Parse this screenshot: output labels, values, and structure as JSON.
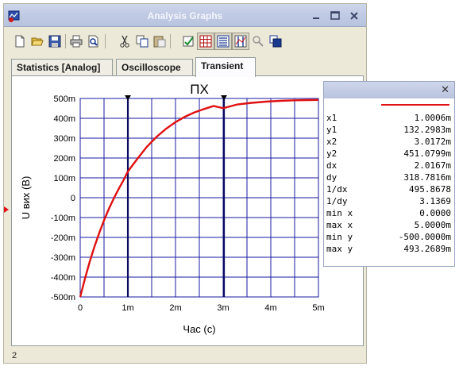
{
  "window": {
    "title": "Analysis Graphs"
  },
  "tabs": [
    {
      "label": "Statistics [Analog]",
      "active": false
    },
    {
      "label": "Oscilloscope",
      "active": false
    },
    {
      "label": "Transient",
      "active": true
    }
  ],
  "toolbar": {
    "buttons": [
      "new-icon",
      "open-icon",
      "save-icon",
      "print-icon",
      "print-preview-icon",
      "cut-icon",
      "copy-icon",
      "paste-icon",
      "properties-icon",
      "grid-icon",
      "legend-icon",
      "cursors-icon",
      "zoom-icon",
      "overlay-icon"
    ]
  },
  "status": {
    "text": "2"
  },
  "chart_data": {
    "type": "line",
    "title": "ПХ",
    "xlabel": "Час (с)",
    "ylabel": "U вих (В)",
    "xlim": [
      0,
      5
    ],
    "ylim": [
      -500,
      500
    ],
    "x_ticks": [
      "0",
      "1m",
      "2m",
      "3m",
      "4m",
      "5m"
    ],
    "y_ticks": [
      "500m",
      "400m",
      "300m",
      "200m",
      "100m",
      "0",
      "-100m",
      "-200m",
      "-300m",
      "-400m",
      "-500m"
    ],
    "grid": true,
    "cursors": [
      1.0006,
      3.0172
    ],
    "series": [
      {
        "color": "#e01010",
        "x": [
          0,
          0.1,
          0.2,
          0.3,
          0.4,
          0.5,
          0.6,
          0.7,
          0.8,
          0.9,
          1.0,
          1.2,
          1.4,
          1.6,
          1.8,
          2.0,
          2.2,
          2.4,
          2.6,
          2.8,
          3.0,
          3.3,
          3.6,
          3.9,
          4.2,
          4.5,
          4.8,
          5.0
        ],
        "y": [
          -500,
          -407,
          -322,
          -246,
          -177,
          -114,
          -57,
          -6,
          41,
          84,
          132,
          196,
          257,
          306,
          347,
          381,
          408,
          430,
          447,
          462,
          451,
          470,
          478,
          484,
          488,
          491,
          492,
          493
        ]
      }
    ]
  },
  "cursor_readout": {
    "rows": [
      {
        "label": "x1",
        "value": "1.0006m"
      },
      {
        "label": "y1",
        "value": "132.2983m"
      },
      {
        "label": "x2",
        "value": "3.0172m"
      },
      {
        "label": "y2",
        "value": "451.0799m"
      },
      {
        "label": "dx",
        "value": "2.0167m"
      },
      {
        "label": "dy",
        "value": "318.7816m"
      },
      {
        "label": "1/dx",
        "value": "495.8678"
      },
      {
        "label": "1/dy",
        "value": "3.1369"
      },
      {
        "label": "min x",
        "value": "0.0000"
      },
      {
        "label": "max x",
        "value": "5.0000m"
      },
      {
        "label": "min y",
        "value": "-500.0000m"
      },
      {
        "label": "max y",
        "value": "493.2689m"
      }
    ]
  }
}
